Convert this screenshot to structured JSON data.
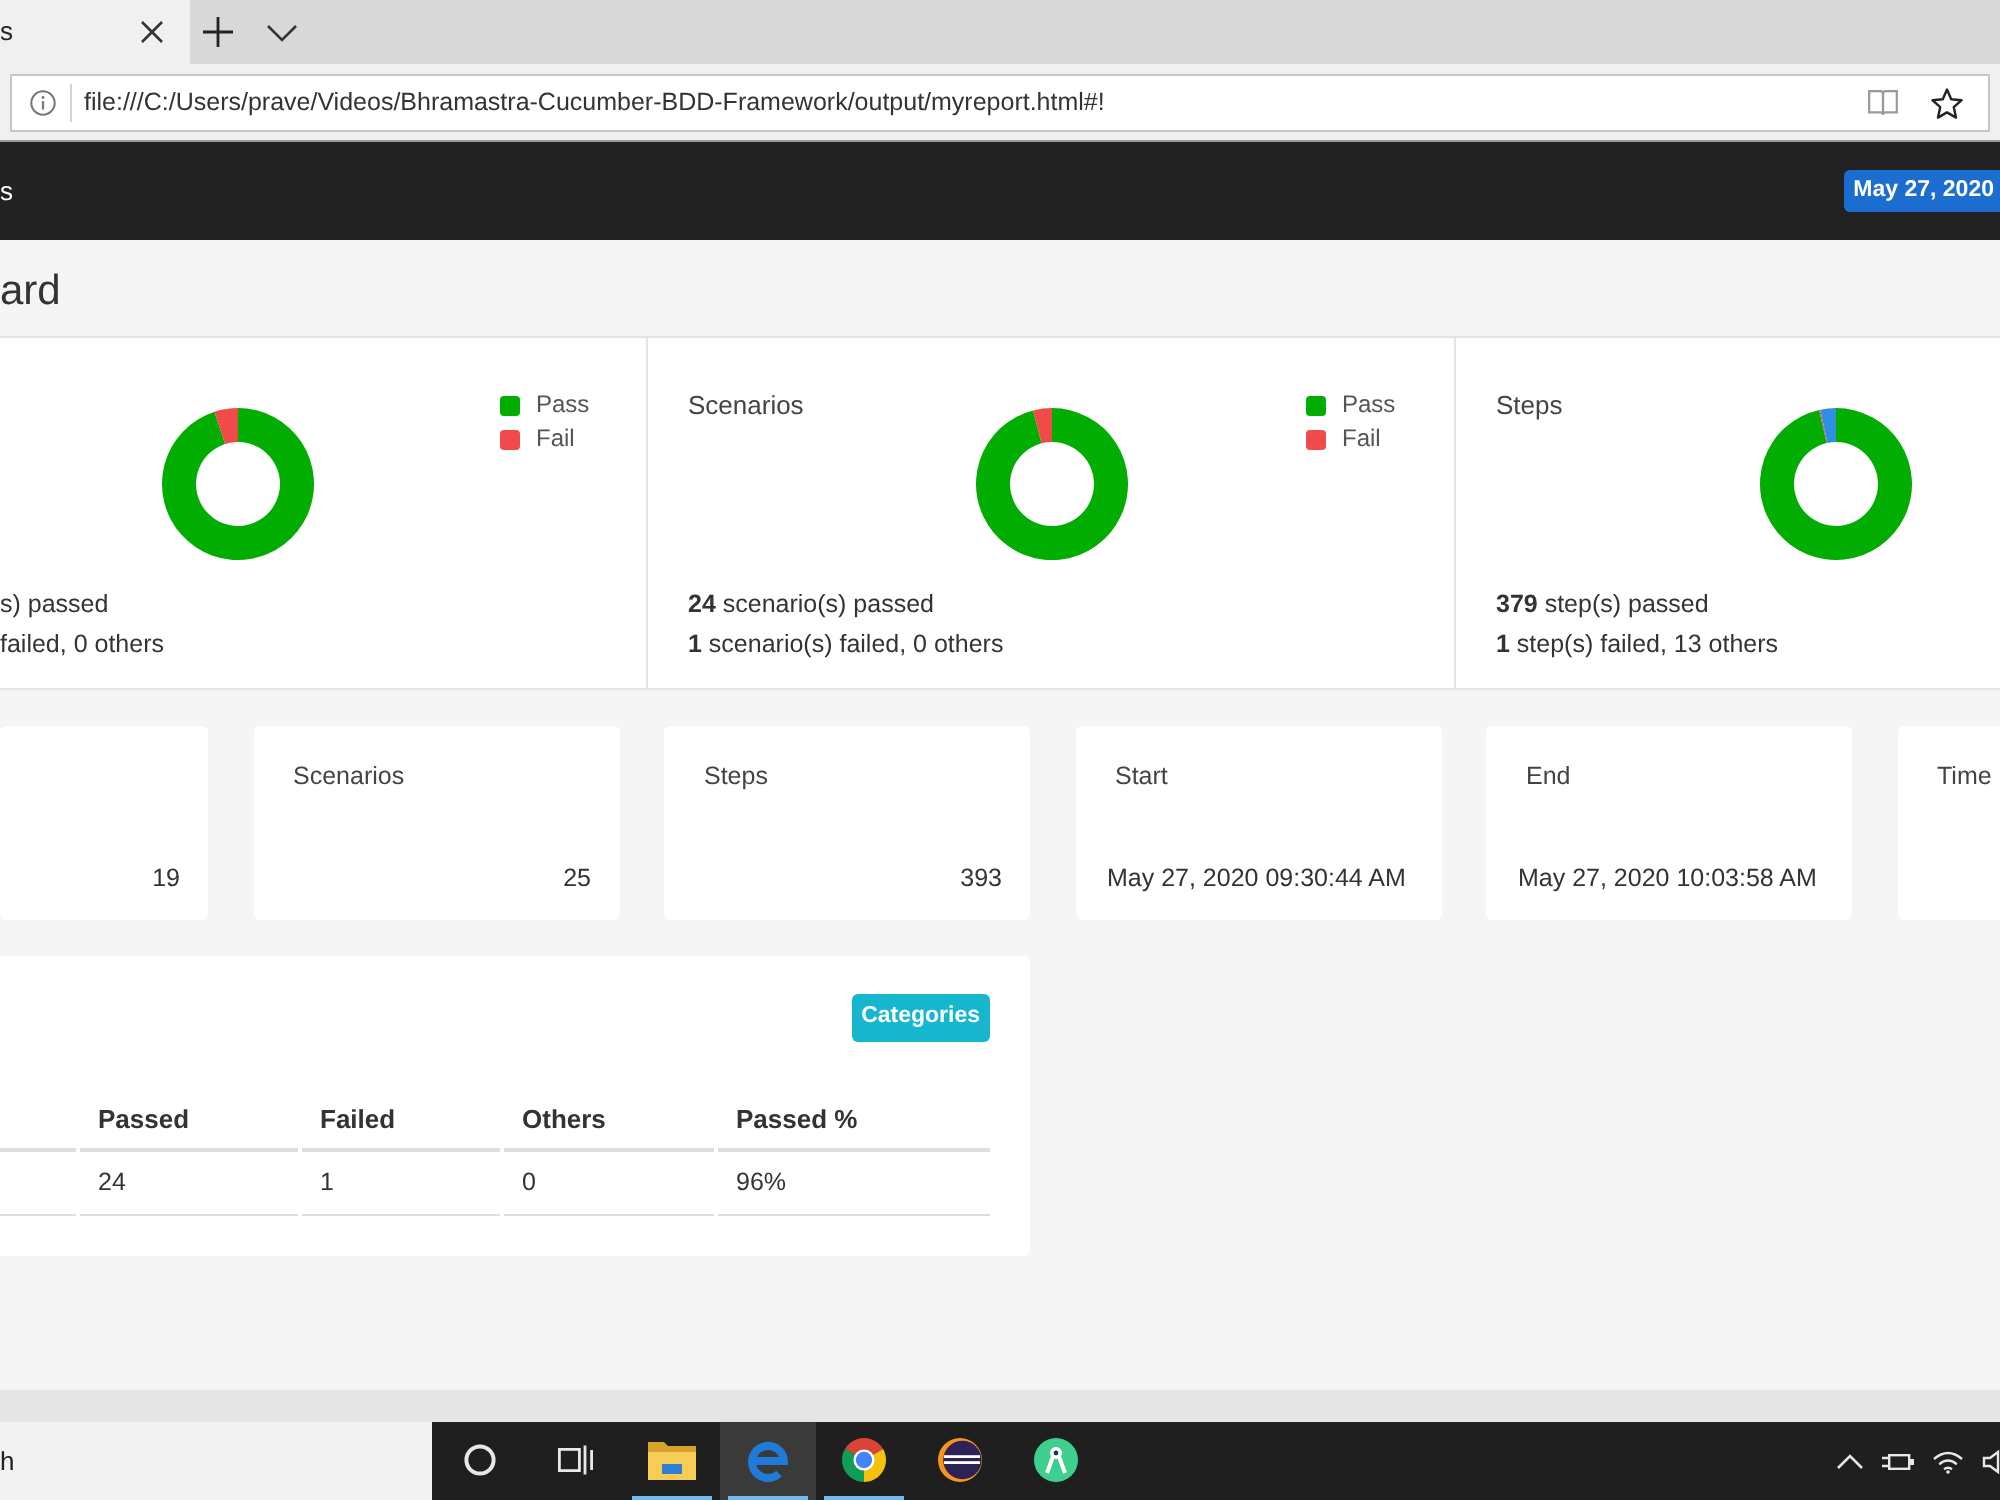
{
  "browser": {
    "tab": {
      "title": "s"
    },
    "address": "file:///C:/Users/prave/Videos/Bhramastra-Cucumber-BDD-Framework/output/myreport.html#!"
  },
  "navbar": {
    "title": "s",
    "date": "May 27, 2020"
  },
  "heading": "ard",
  "chart_cards": [
    {
      "chart_data": {
        "type": "donut",
        "categories": [
          "Pass",
          "Fail"
        ],
        "values": [
          95,
          5
        ],
        "colors": [
          "#00ad00",
          "#f04a4a"
        ]
      },
      "passed": "s) passed",
      "failed": "failed, 0 others"
    },
    {
      "title": "Scenarios",
      "chart_data": {
        "type": "donut",
        "categories": [
          "Pass",
          "Fail"
        ],
        "values": [
          96,
          4
        ],
        "colors": [
          "#00ad00",
          "#f04a4a"
        ]
      },
      "passed": "**24** scenario(s) passed",
      "failed": "**1** scenario(s) failed, 0 others"
    },
    {
      "title": "Steps",
      "chart_data": {
        "type": "donut",
        "values": [
          96.44,
          0.25,
          3.31
        ],
        "colors": [
          "#00ad00",
          "#f04a4a",
          "#2f8fe0"
        ]
      },
      "passed": "**379** step(s) passed",
      "failed": "**1** step(s) failed, 13 others"
    }
  ],
  "stat_cards": [
    {
      "kind": "count",
      "value": "19"
    },
    {
      "kind": "count",
      "title": "Scenarios",
      "value": "25"
    },
    {
      "kind": "count",
      "title": "Steps",
      "value": "393"
    },
    {
      "kind": "time",
      "title": "Start",
      "value": "May 27, 2020 09:30:44 AM"
    },
    {
      "kind": "time",
      "title": "End",
      "value": "May 27, 2020 10:03:58 AM"
    },
    {
      "kind": "time",
      "title": "Time"
    }
  ],
  "categories": {
    "button": "Categories",
    "columns": [
      "Passed",
      "Failed",
      "Others",
      "Passed %"
    ],
    "rows": [
      [
        "24",
        "1",
        "0",
        "96%"
      ]
    ]
  },
  "taskbar": {
    "search": {
      "placeholder": "h"
    },
    "apps": [
      {
        "kind": "circle",
        "running": false,
        "selected": false
      },
      {
        "kind": "taskview",
        "running": false,
        "selected": false
      },
      {
        "kind": "folder",
        "running": true,
        "selected": false
      },
      {
        "kind": "ebrowser",
        "running": true,
        "selected": true
      },
      {
        "kind": "segmented",
        "running": true,
        "selected": false
      },
      {
        "kind": "striped",
        "running": false,
        "selected": false
      },
      {
        "kind": "compass",
        "running": false,
        "selected": false
      }
    ]
  }
}
